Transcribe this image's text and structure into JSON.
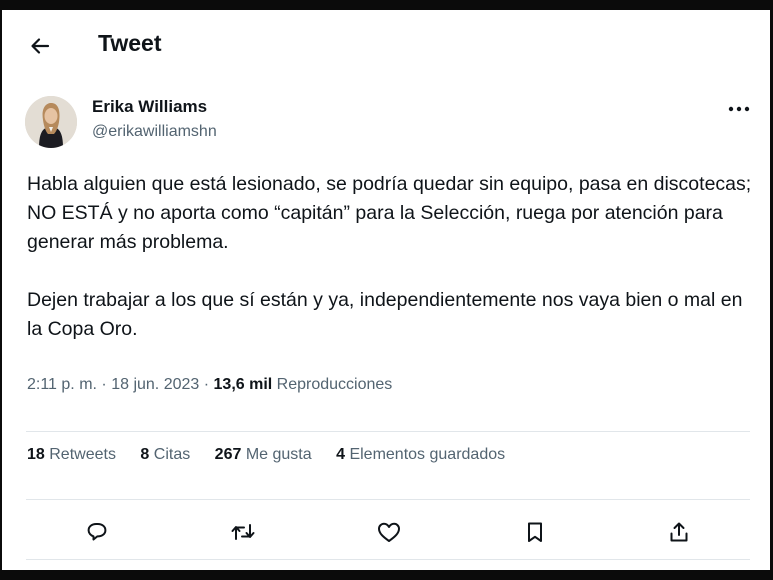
{
  "header": {
    "title": "Tweet"
  },
  "author": {
    "name": "Erika Williams",
    "handle": "@erikawilliamshn"
  },
  "tweet": {
    "paragraphs": [
      "Habla alguien que está lesionado, se podría quedar sin equipo, pasa en discotecas; NO ESTÁ y no aporta como “capitán” para la Selección, ruega por atención para generar más problema.",
      "Dejen trabajar a los que sí están y ya, independientemente nos vaya bien o mal en la Copa Oro."
    ]
  },
  "meta": {
    "time": "2:11 p. m.",
    "sep1": "·",
    "date": "18 jun. 2023",
    "sep2": "·",
    "views_count": "13,6 mil",
    "views_label": "Reproducciones"
  },
  "stats": [
    {
      "count": "18",
      "label": "Retweets"
    },
    {
      "count": "8",
      "label": "Citas"
    },
    {
      "count": "267",
      "label": "Me gusta"
    },
    {
      "count": "4",
      "label": "Elementos guardados"
    }
  ],
  "icons": {
    "back": "arrow-left-icon",
    "more": "more-horizontal-icon",
    "reply": "reply-icon",
    "retweet": "retweet-icon",
    "like": "heart-icon",
    "bookmark": "bookmark-icon",
    "share": "share-icon"
  },
  "colors": {
    "text_primary": "#0f1419",
    "text_secondary": "#536471",
    "divider": "#e1e6ea",
    "background": "#ffffff"
  }
}
